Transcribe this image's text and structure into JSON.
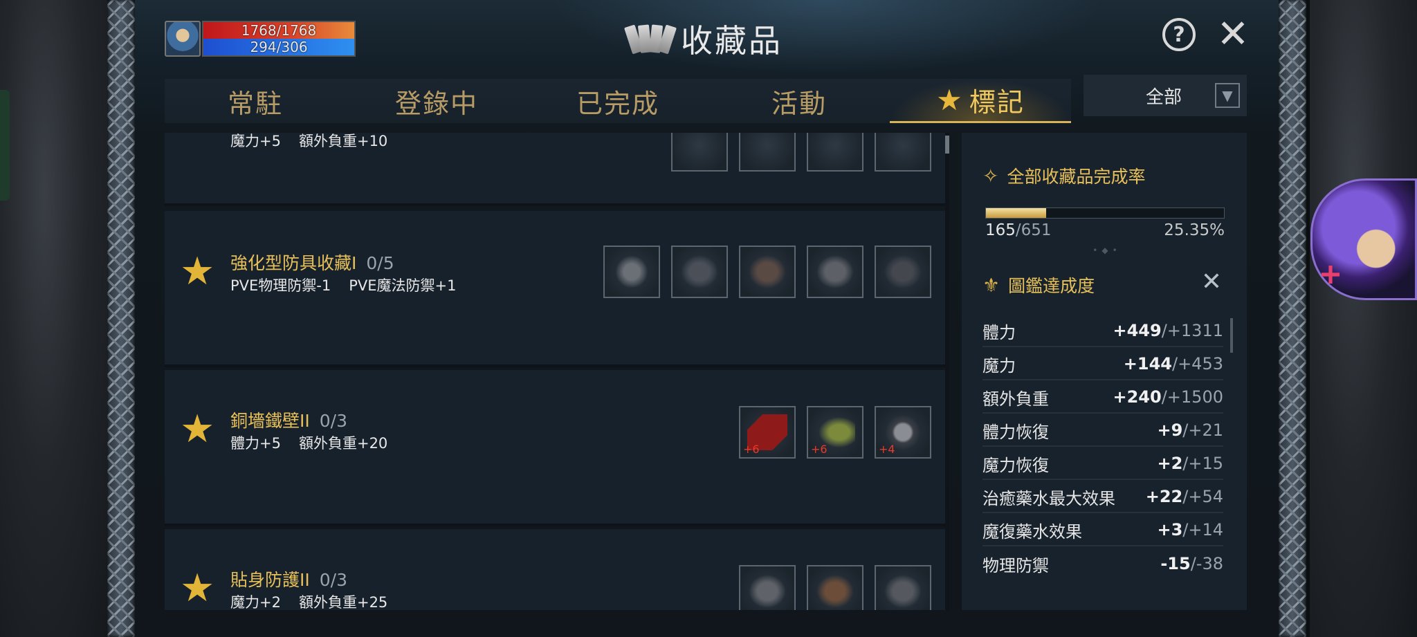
{
  "status": {
    "hp": "1768/1768",
    "mp": "294/306"
  },
  "header": {
    "title": "收藏品"
  },
  "tabs": [
    {
      "label": "常駐"
    },
    {
      "label": "登錄中"
    },
    {
      "label": "已完成"
    },
    {
      "label": "活動"
    },
    {
      "label": "標記",
      "active": true
    }
  ],
  "filter": {
    "value": "全部"
  },
  "cards": [
    {
      "name": "",
      "progress": "",
      "stats": [
        "魔力+5",
        "額外負重+10"
      ],
      "slots": 4
    },
    {
      "name": "強化型防具收藏I",
      "progress": "0/5",
      "stats": [
        "PVE物理防禦-1",
        "PVE魔法防禦+1"
      ],
      "slots": 5
    },
    {
      "name": "銅墻鐵壁II",
      "progress": "0/3",
      "stats": [
        "體力+5",
        "額外負重+20"
      ],
      "slots": 3,
      "enchant": [
        "+6",
        "+6",
        "+4"
      ]
    },
    {
      "name": "貼身防護II",
      "progress": "0/3",
      "stats": [
        "魔力+2",
        "額外負重+25"
      ],
      "slots": 3
    }
  ],
  "side": {
    "completion_title": "全部收藏品完成率",
    "completion_count": "165",
    "completion_total": "/651",
    "completion_pct": "25.35%",
    "completion_fraction": 0.2535,
    "codex_title": "圖鑑達成度",
    "stats": [
      {
        "label": "體力",
        "cur": "+449",
        "max": "/+1311"
      },
      {
        "label": "魔力",
        "cur": "+144",
        "max": "/+453"
      },
      {
        "label": "額外負重",
        "cur": "+240",
        "max": "/+1500"
      },
      {
        "label": "體力恢復",
        "cur": "+9",
        "max": "/+21"
      },
      {
        "label": "魔力恢復",
        "cur": "+2",
        "max": "/+15"
      },
      {
        "label": "治癒藥水最大效果",
        "cur": "+22",
        "max": "/+54"
      },
      {
        "label": "魔復藥水效果",
        "cur": "+3",
        "max": "/+14"
      },
      {
        "label": "物理防禦",
        "cur": "-15",
        "max": "/-38"
      }
    ]
  },
  "colors": {
    "accent_gold": "#e8c059",
    "hp": "#c0171b",
    "mp": "#1d4fd0"
  }
}
